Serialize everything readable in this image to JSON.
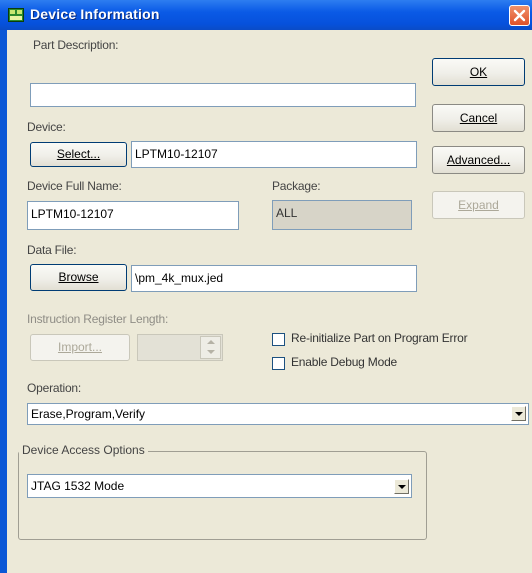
{
  "window": {
    "title": "Device Information"
  },
  "part_description": {
    "label": "Part Description:",
    "value": ""
  },
  "device": {
    "label": "Device:",
    "select_label": "Select...",
    "value": "LPTM10-12107"
  },
  "device_full_name": {
    "label": "Device Full Name:",
    "value": "LPTM10-12107"
  },
  "package": {
    "label": "Package:",
    "value": "ALL"
  },
  "data_file": {
    "label": "Data File:",
    "browse_label": "Browse",
    "value": "\\pm_4k_mux.jed"
  },
  "instruction_register": {
    "label": "Instruction Register Length:",
    "import_label": "Import...",
    "value": ""
  },
  "checkboxes": [
    {
      "label": "Re-initialize Part on Program Error",
      "checked": false
    },
    {
      "label": "Enable Debug Mode",
      "checked": false
    }
  ],
  "operation": {
    "label": "Operation:",
    "value": "Erase,Program,Verify"
  },
  "device_access": {
    "group_label": "Device Access Options",
    "value": "JTAG 1532 Mode"
  },
  "buttons": {
    "ok": "OK",
    "cancel": "Cancel",
    "advanced": "Advanced...",
    "expand": "Expand"
  },
  "colors": {
    "titlebar": "#0a5ae6",
    "client": "#ece9d8",
    "close": "#e0522a"
  }
}
